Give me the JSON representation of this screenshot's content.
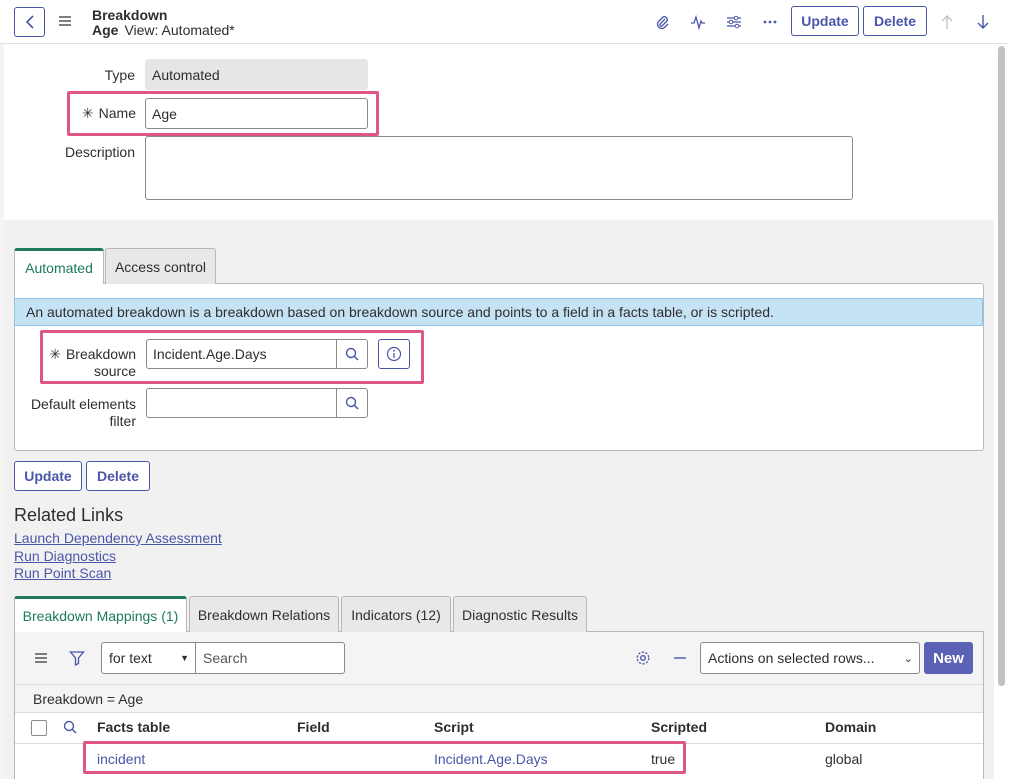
{
  "header": {
    "title": "Breakdown",
    "record_name": "Age",
    "view_label": "View: Automated*",
    "update_label": "Update",
    "delete_label": "Delete"
  },
  "form": {
    "type_label": "Type",
    "type_value": "Automated",
    "name_label": "Name",
    "name_value": "Age",
    "description_label": "Description",
    "description_value": ""
  },
  "tabs": [
    {
      "label": "Automated",
      "active": true
    },
    {
      "label": "Access control",
      "active": false
    }
  ],
  "automated": {
    "info": "An automated breakdown is a breakdown based on breakdown source and points to a field in a facts table, or is scripted.",
    "source_label_1": "Breakdown",
    "source_label_2": "source",
    "source_value": "Incident.Age.Days",
    "default_filter_label_1": "Default elements",
    "default_filter_label_2": "filter",
    "default_filter_value": ""
  },
  "bottom_buttons": {
    "update": "Update",
    "delete": "Delete"
  },
  "related_links": {
    "title": "Related Links",
    "links": [
      "Launch Dependency Assessment",
      "Run Diagnostics",
      "Run Point Scan"
    ]
  },
  "related_tabs": [
    {
      "label": "Breakdown Mappings (1)",
      "active": true
    },
    {
      "label": "Breakdown Relations",
      "active": false
    },
    {
      "label": "Indicators (12)",
      "active": false
    },
    {
      "label": "Diagnostic Results",
      "active": false
    }
  ],
  "list": {
    "search_field_value": "for text",
    "search_placeholder": "Search",
    "actions_value": "Actions on selected rows...",
    "new_label": "New",
    "breadcrumb": "Breakdown = Age",
    "columns": [
      "Facts table",
      "Field",
      "Script",
      "Scripted",
      "Domain"
    ],
    "rows": [
      {
        "facts_table": "incident",
        "field": "",
        "script": "Incident.Age.Days",
        "scripted": "true",
        "domain": "global"
      }
    ]
  },
  "colors": {
    "accent": "#4a56a8",
    "active_tab": "#1d7a5c",
    "highlight": "#e05688",
    "info_bg": "#c6e3f5"
  }
}
